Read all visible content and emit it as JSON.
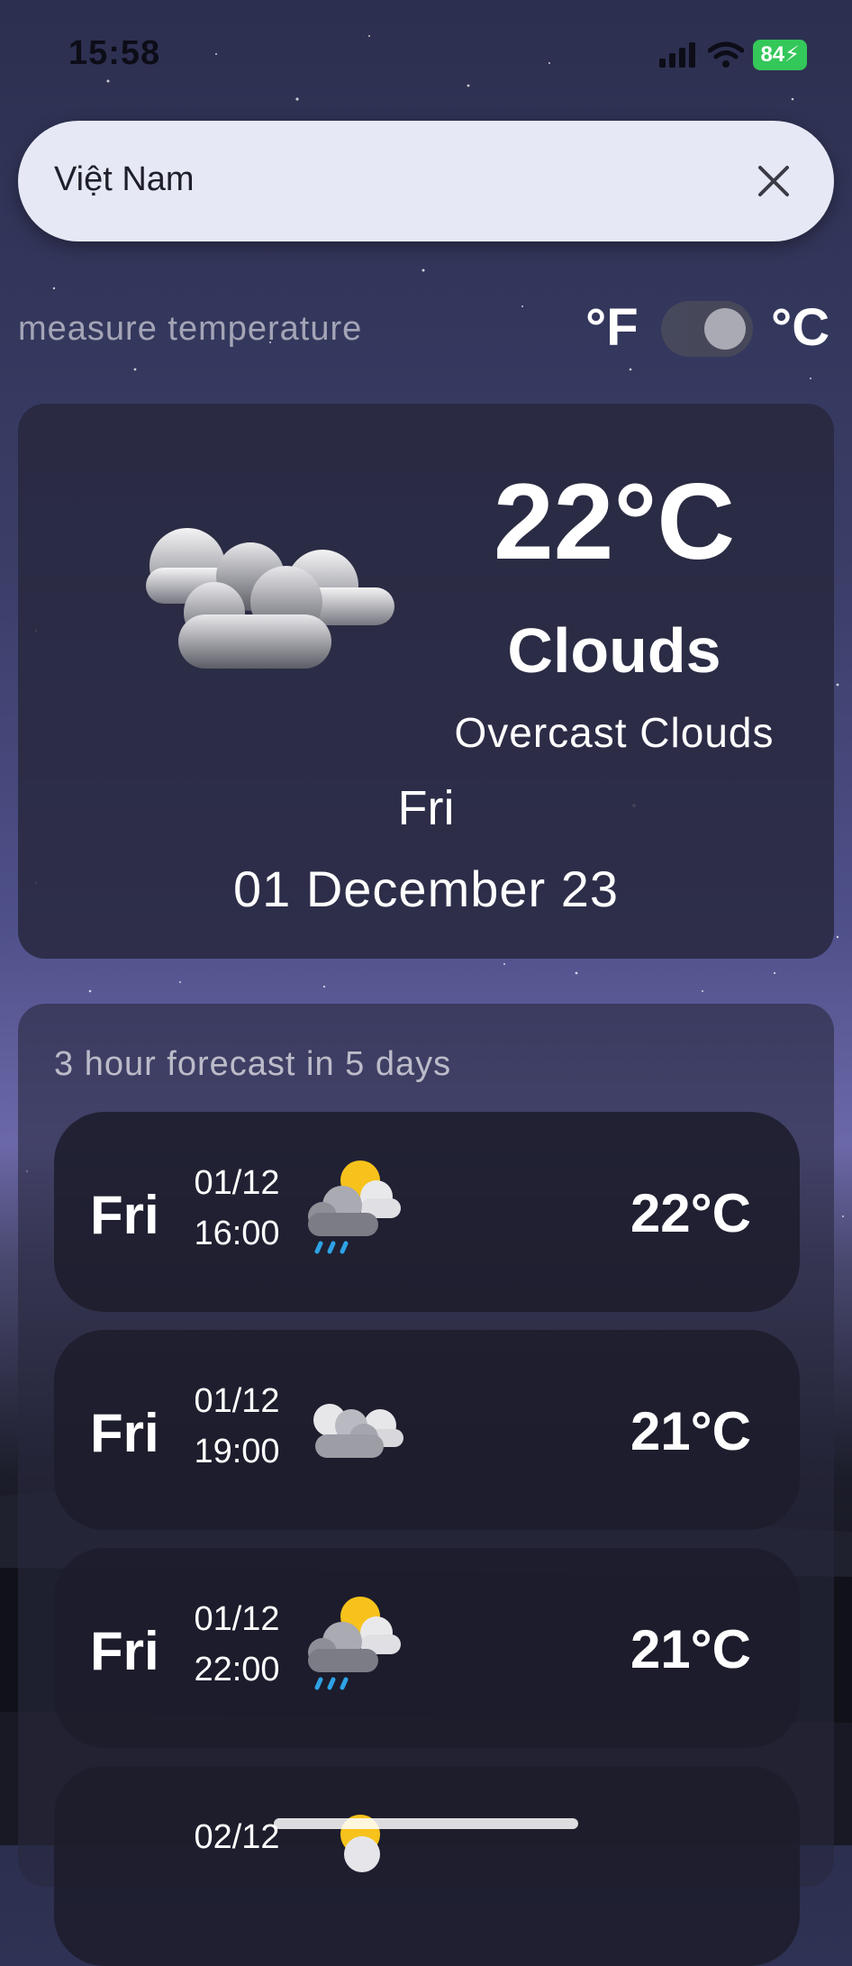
{
  "status_bar": {
    "time": "15:58",
    "battery": "84"
  },
  "search": {
    "value": "Việt Nam"
  },
  "measure": {
    "label": "measure temperature",
    "unit_left": "°F",
    "unit_right": "°C",
    "celsius_selected": true
  },
  "current": {
    "temperature": "22°C",
    "condition": "Clouds",
    "description": "Overcast Clouds",
    "day": "Fri",
    "date": "01 December 23",
    "icon": "clouds-icon"
  },
  "forecast": {
    "title": "3 hour forecast in 5 days",
    "items": [
      {
        "day": "Fri",
        "date": "01/12",
        "time": "16:00",
        "temp": "22°C",
        "icon": "rain-sun-cloud-icon"
      },
      {
        "day": "Fri",
        "date": "01/12",
        "time": "19:00",
        "temp": "21°C",
        "icon": "clouds-icon"
      },
      {
        "day": "Fri",
        "date": "01/12",
        "time": "22:00",
        "temp": "21°C",
        "icon": "rain-sun-cloud-icon"
      },
      {
        "day": "",
        "date": "02/12",
        "time": "",
        "temp": "",
        "icon": "sun-cloud-icon"
      }
    ]
  },
  "colors": {
    "search_bg": "#e6e9f5",
    "card_bg": "#28283e",
    "battery_green": "#34c759",
    "rain_blue": "#2ea3e6",
    "sun_yellow": "#f7c21b"
  }
}
